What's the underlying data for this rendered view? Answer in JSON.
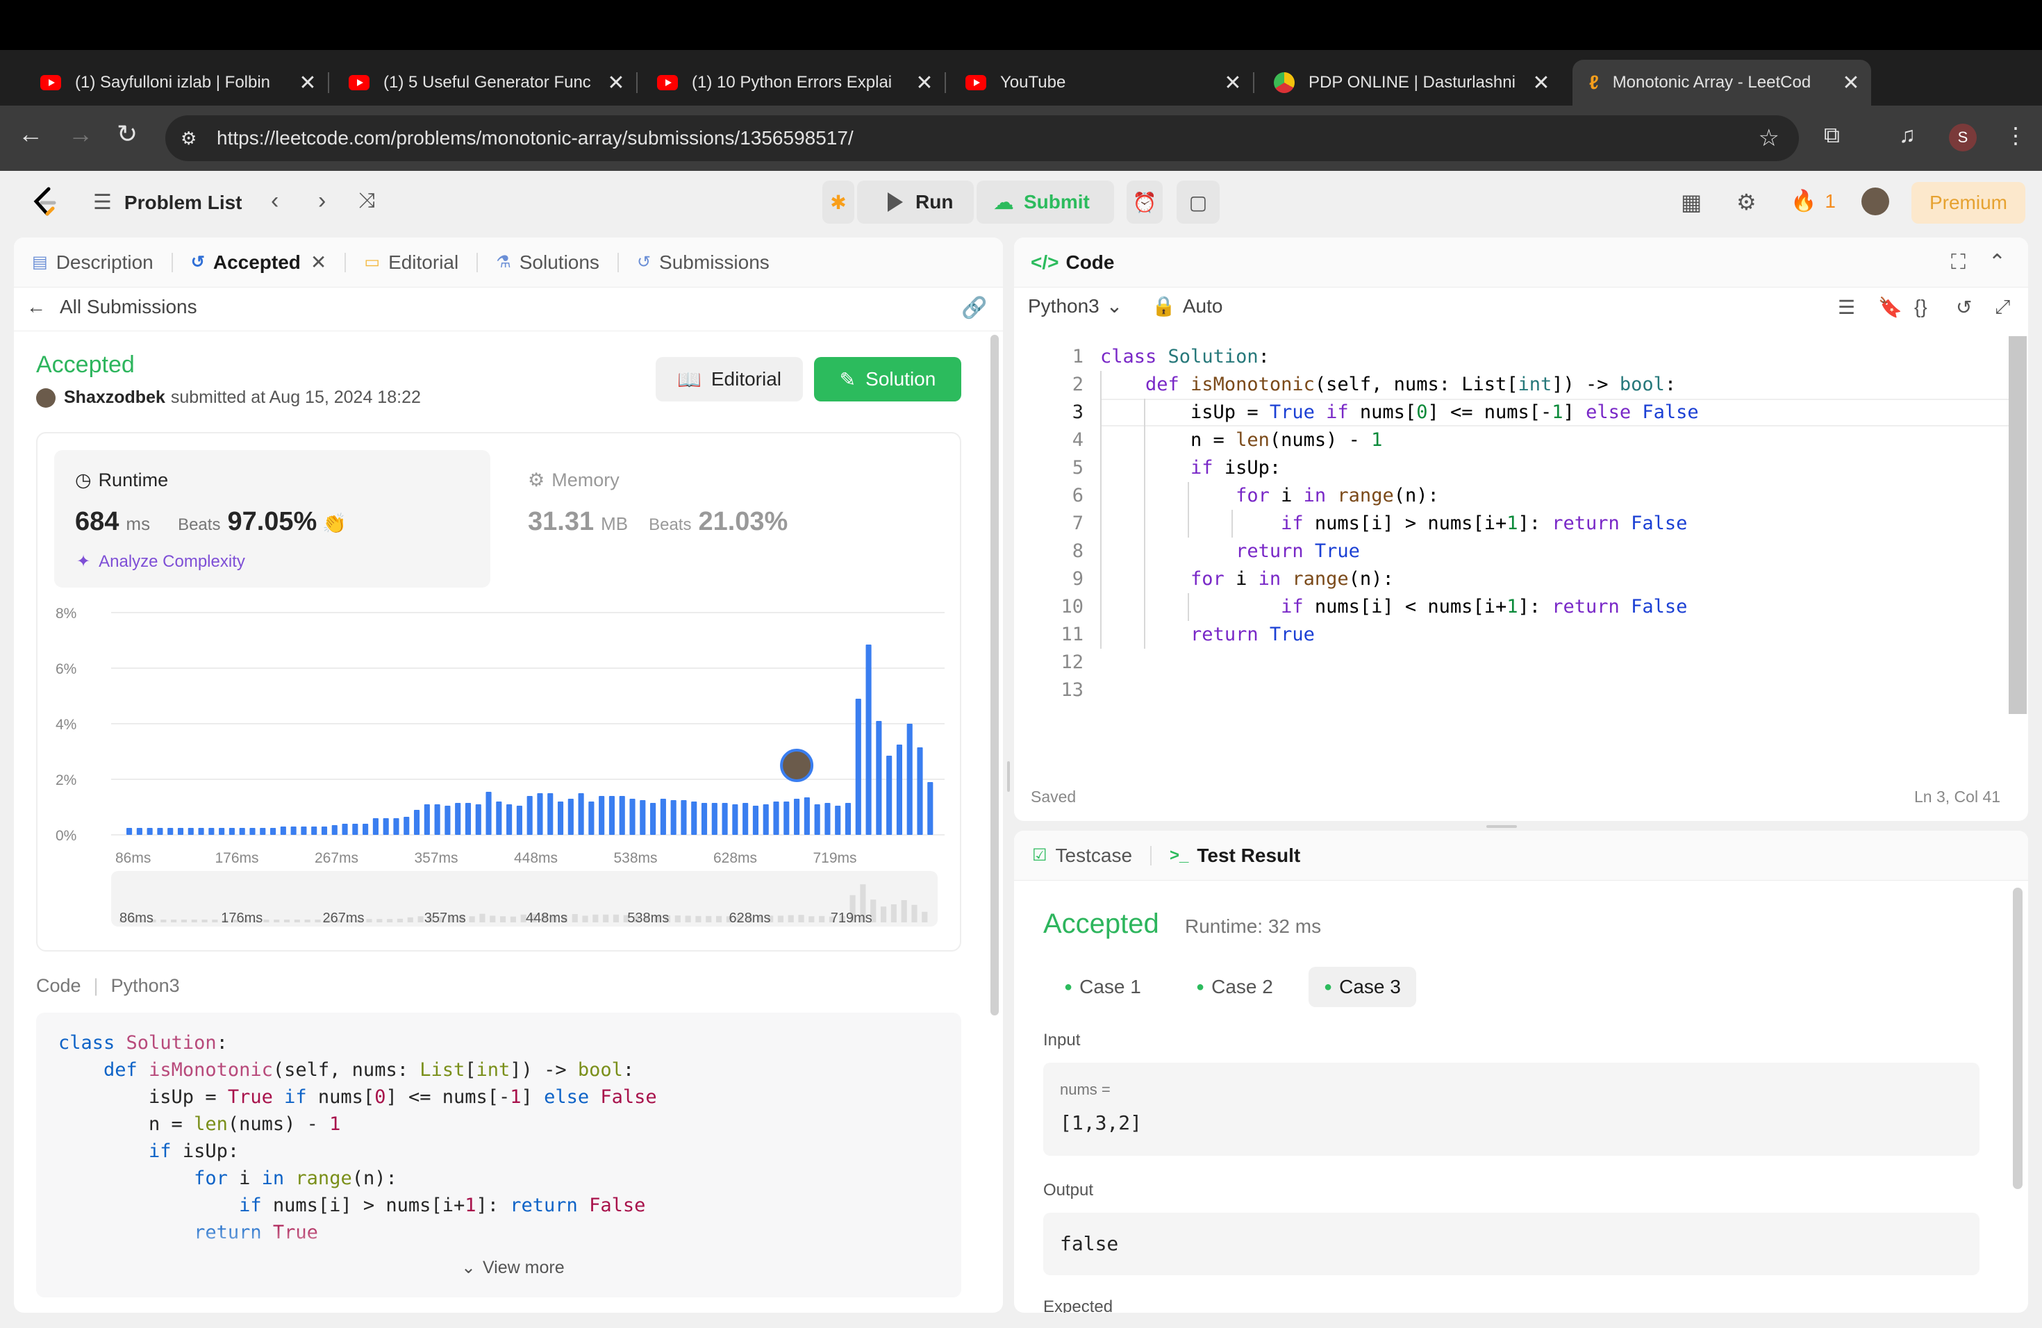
{
  "browser": {
    "tabs": [
      {
        "title": "(1) Sayfulloni izlab | Folbin",
        "icon": "youtube-icon"
      },
      {
        "title": "(1) 5 Useful Generator Func",
        "icon": "youtube-icon"
      },
      {
        "title": "(1) 10 Python Errors Explai",
        "icon": "youtube-icon"
      },
      {
        "title": "YouTube",
        "icon": "youtube-icon"
      },
      {
        "title": "PDP ONLINE | Dasturlashni",
        "icon": "pdp-icon"
      },
      {
        "title": "Monotonic Array - LeetCod",
        "icon": "leetcode-icon"
      }
    ],
    "new_tab": "+",
    "url": "https://leetcode.com/problems/monotonic-array/submissions/1356598517/",
    "profile_initial": "S"
  },
  "header": {
    "problem_list": "Problem List",
    "run": "Run",
    "submit": "Submit",
    "streak": "1",
    "premium": "Premium"
  },
  "left": {
    "tabs": [
      "Description",
      "Accepted",
      "Editorial",
      "Solutions",
      "Submissions"
    ],
    "all_submissions": "All Submissions",
    "status": "Accepted",
    "user": "Shaxzodbek",
    "submitted_text": "submitted at Aug 15, 2024 18:22",
    "editorial_btn": "Editorial",
    "solution_btn": "Solution",
    "runtime_label": "Runtime",
    "runtime_value": "684",
    "runtime_unit": "ms",
    "beats_label": "Beats",
    "runtime_beats": "97.05%",
    "analyze": "Analyze Complexity",
    "memory_label": "Memory",
    "memory_value": "31.31",
    "memory_unit": "MB",
    "memory_beats": "21.03%",
    "code_label": "Code",
    "code_lang": "Python3",
    "view_more": "View more"
  },
  "chart_data": {
    "type": "bar",
    "y_ticks": [
      "8%",
      "6%",
      "4%",
      "2%",
      "0%"
    ],
    "ylim": [
      0,
      8
    ],
    "x_ticks": [
      "86ms",
      "176ms",
      "267ms",
      "357ms",
      "448ms",
      "538ms",
      "628ms",
      "719ms"
    ],
    "values": [
      0.25,
      0.25,
      0.25,
      0.25,
      0.25,
      0.25,
      0.25,
      0.25,
      0.25,
      0.25,
      0.25,
      0.25,
      0.25,
      0.25,
      0.25,
      0.3,
      0.3,
      0.3,
      0.3,
      0.3,
      0.35,
      0.4,
      0.4,
      0.4,
      0.6,
      0.6,
      0.6,
      0.65,
      0.9,
      1.1,
      1.1,
      1.05,
      1.15,
      1.15,
      1.1,
      1.55,
      1.2,
      1.1,
      1.05,
      1.4,
      1.5,
      1.5,
      1.2,
      1.3,
      1.5,
      1.2,
      1.4,
      1.4,
      1.4,
      1.3,
      1.25,
      1.15,
      1.3,
      1.25,
      1.25,
      1.2,
      1.15,
      1.15,
      1.15,
      1.1,
      1.15,
      1.05,
      1.1,
      1.2,
      1.2,
      1.3,
      1.35,
      1.1,
      1.15,
      1.05,
      1.15,
      4.9,
      6.85,
      4.1,
      2.85,
      3.25,
      4.0,
      3.15,
      1.9
    ],
    "user_bar_index": 65,
    "bar_color": "#3a7ef0"
  },
  "editor": {
    "title": "Code",
    "lang": "Python3",
    "auto": "Auto",
    "saved": "Saved",
    "cursor": "Ln 3, Col 41",
    "line_numbers": [
      "1",
      "2",
      "3",
      "4",
      "5",
      "6",
      "7",
      "8",
      "9",
      "10",
      "11",
      "12",
      "13"
    ]
  },
  "bottom": {
    "testcase_tab": "Testcase",
    "result_tab": "Test Result",
    "status": "Accepted",
    "runtime": "Runtime: 32 ms",
    "cases": [
      "Case 1",
      "Case 2",
      "Case 3"
    ],
    "input_label": "Input",
    "var_label": "nums =",
    "input_value": "[1,3,2]",
    "output_label": "Output",
    "output_value": "false",
    "expected_label": "Expected"
  },
  "colors": {
    "accent_green": "#2cbb5d",
    "accepted_green": "#2db55d",
    "premium": "#e6a231",
    "bar": "#3a7ef0"
  }
}
